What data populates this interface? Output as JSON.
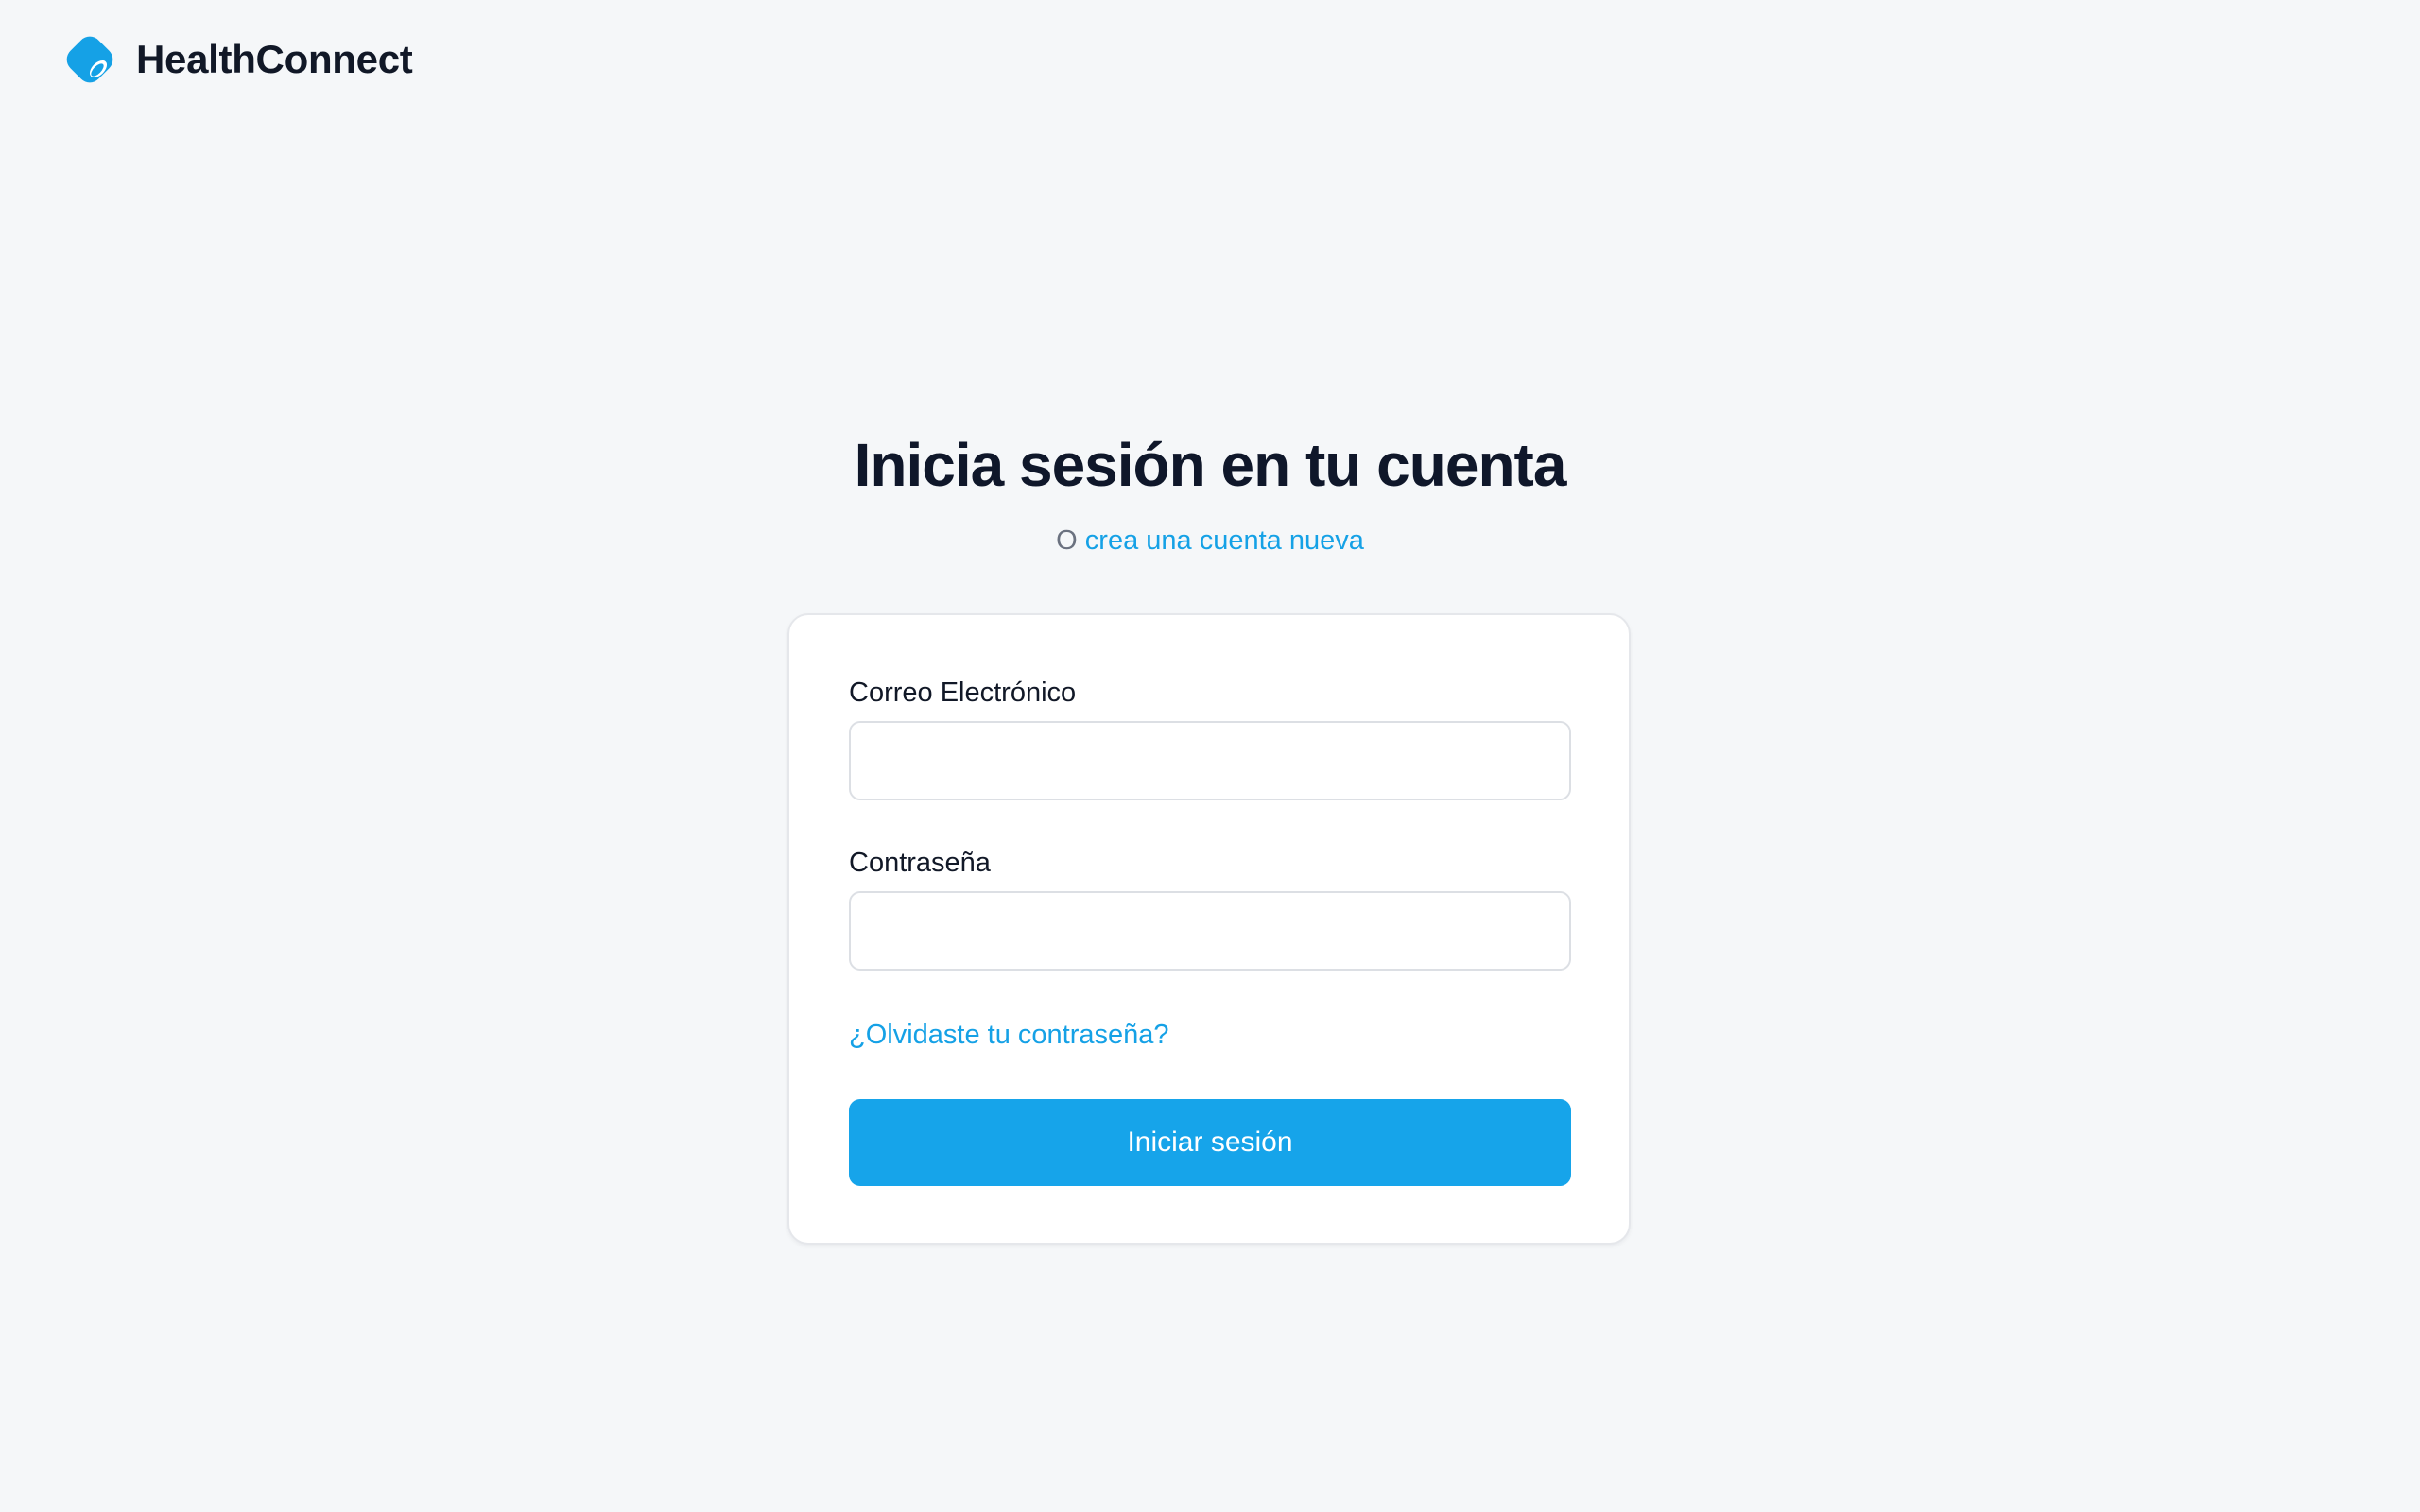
{
  "brand": {
    "name": "HealthConnect",
    "logo_icon": "droplet-capsule-icon",
    "color": "#15a1e6"
  },
  "login": {
    "title": "Inicia sesión en tu cuenta",
    "subtitle_prefix": "O",
    "create_account_link": "crea una cuenta nueva",
    "email": {
      "label": "Correo Electrónico",
      "value": "",
      "placeholder": ""
    },
    "password": {
      "label": "Contraseña",
      "value": "",
      "placeholder": ""
    },
    "forgot_password_link": "¿Olvidaste tu contraseña?",
    "submit_label": "Iniciar sesión"
  },
  "colors": {
    "accent": "#15a1e6",
    "background": "#f5f7f9",
    "card": "#ffffff"
  }
}
